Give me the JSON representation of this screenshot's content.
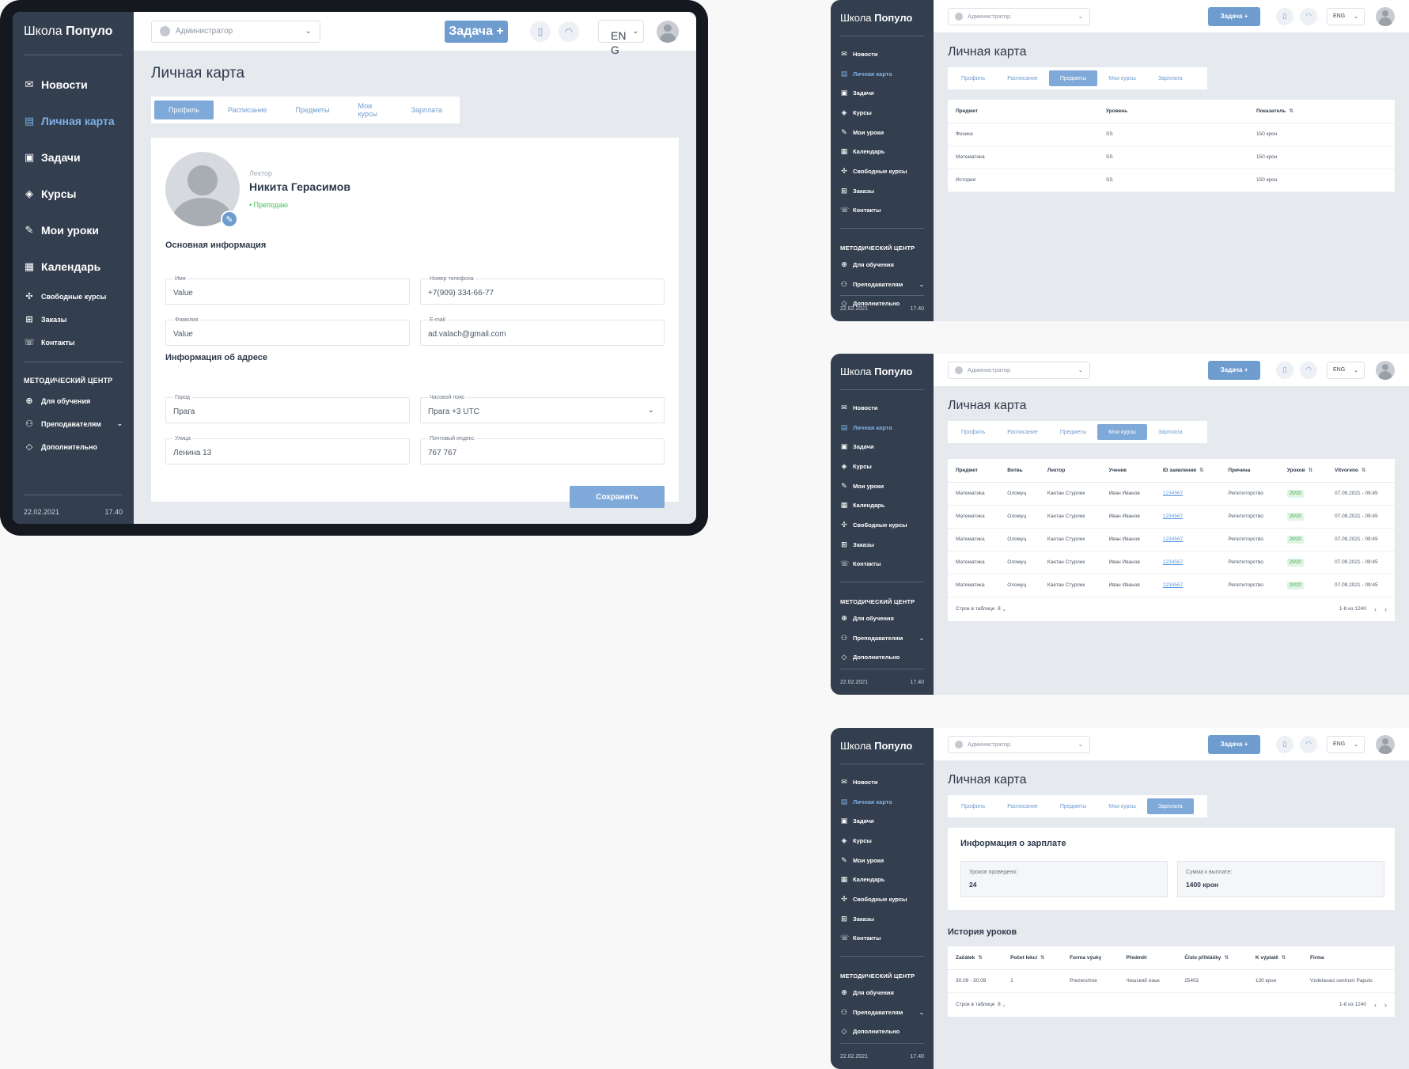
{
  "app": {
    "brand_light": "Школа",
    "brand_bold": "Популо"
  },
  "topbar": {
    "role": "Администратор",
    "task_button": "Задача +",
    "lang_large": "ENG",
    "lang_small": "ENG"
  },
  "sidebar_large": {
    "items": [
      {
        "label": "Новости",
        "icon": "mail-icon"
      },
      {
        "label": "Личная карта",
        "icon": "id-card-icon"
      },
      {
        "label": "Задачи",
        "icon": "inbox-icon"
      },
      {
        "label": "Курсы",
        "icon": "graduation-cap-icon"
      },
      {
        "label": "Мои уроки",
        "icon": "edit-icon"
      },
      {
        "label": "Календарь",
        "icon": "calendar-icon"
      }
    ],
    "small_items": [
      {
        "label": "Свободные курсы",
        "icon": "puzzle-icon"
      },
      {
        "label": "Заказы",
        "icon": "orders-icon"
      },
      {
        "label": "Контакты",
        "icon": "phone-icon"
      }
    ],
    "section": "МЕТОДИЧЕСКИЙ ЦЕНТР",
    "section_items": [
      {
        "label": "Для обучения",
        "icon": "add-folder-icon"
      },
      {
        "label": "Преподавателям",
        "icon": "users-icon"
      },
      {
        "label": "Дополнительно",
        "icon": "diamond-icon"
      }
    ],
    "date": "22.02.2021",
    "time": "17.40"
  },
  "sidebar_small": {
    "items": [
      "Новости",
      "Личная карта",
      "Задачи",
      "Курсы",
      "Мои уроки",
      "Календарь",
      "Свободные курсы",
      "Заказы",
      "Контакты"
    ],
    "section": "МЕТОДИЧЕСКИЙ ЦЕНТР",
    "section_items": [
      "Для обучения",
      "Преподавателям",
      "Дополнительно"
    ],
    "date": "22.02.2021",
    "time": "17.40"
  },
  "page_title": "Личная карта",
  "tabs": [
    "Профиль",
    "Расписание",
    "Предметы",
    "Мои курсы",
    "Зарплата"
  ],
  "profile": {
    "role": "Лектор",
    "name": "Никита Герасимов",
    "status": "• Преподаю",
    "basic_info_heading": "Основная информация",
    "address_heading": "Информация об адресе",
    "fields": {
      "first_name": {
        "label": "Имя",
        "value": "Value"
      },
      "phone": {
        "label": "Номер телефона",
        "value": "+7(909) 334-66-77"
      },
      "last_name": {
        "label": "Фамилия",
        "value": "Value"
      },
      "email": {
        "label": "E-mail",
        "value": "ad.valach@gmail.com"
      },
      "city": {
        "label": "Город",
        "value": "Прага"
      },
      "timezone": {
        "label": "Часовой пояс",
        "value": "Прага +3 UTC"
      },
      "street": {
        "label": "Улица",
        "value": "Ленина 13"
      },
      "zip": {
        "label": "Почтовый индекс",
        "value": "767 767"
      }
    },
    "save_button": "Сохранить"
  },
  "subjects": {
    "headers": [
      "Предмет",
      "Уровень",
      "Показатель"
    ],
    "rows": [
      [
        "Физика",
        "SS",
        "150 крон"
      ],
      [
        "Математика",
        "SS",
        "150 крон"
      ],
      [
        "История",
        "SS",
        "150 крон"
      ]
    ]
  },
  "courses": {
    "headers": [
      "Предмет",
      "Ветвь",
      "Лектор",
      "Ученик",
      "ID заявления",
      "Причина",
      "Уроков",
      "Vitvoreno"
    ],
    "rows": [
      [
        "Математика",
        "Оломуц",
        "Каетан Стурлик",
        "Иван Иванов",
        "1234567",
        "Репетиторство",
        "20/20",
        "07.09.2021 - 09:45"
      ],
      [
        "Математика",
        "Оломуц",
        "Каетан Стурлик",
        "Иван Иванов",
        "1234567",
        "Репетиторство",
        "20/20",
        "07.09.2021 - 09:45"
      ],
      [
        "Математика",
        "Оломуц",
        "Каетан Стурлик",
        "Иван Иванов",
        "1234567",
        "Репетиторство",
        "20/20",
        "07.09.2021 - 09:45"
      ],
      [
        "Математика",
        "Оломуц",
        "Каетан Стурлик",
        "Иван Иванов",
        "1234567",
        "Репетиторство",
        "20/20",
        "07.09.2021 - 09:45"
      ],
      [
        "Математика",
        "Оломуц",
        "Каетан Стурлик",
        "Иван Иванов",
        "1234567",
        "Репетиторство",
        "20/20",
        "07.09.2021 - 09:45"
      ]
    ],
    "rows_label": "Строк в таблице",
    "rows_value": "8",
    "range": "1-8 из 1240"
  },
  "salary": {
    "heading": "Информация о зарплате",
    "lessons_label": "Уроков проведено:",
    "lessons_value": "24",
    "sum_label": "Сумма к выплате:",
    "sum_value": "1400 крон",
    "history_heading": "История уроков",
    "headers": [
      "Začátek",
      "Počet lekcí",
      "Forma výuky",
      "Předmět",
      "Číslo přihlášky",
      "K výplatě",
      "Firma"
    ],
    "rows": [
      [
        "30.09 - 30.09",
        "1",
        "Prezenchne",
        "Чешский язык",
        "25402",
        "130 крон",
        "Vzdelavaci centrum Papulo"
      ]
    ],
    "rows_label": "Строк в таблице",
    "rows_value": "8",
    "range": "1-8 из 1240"
  },
  "colors": {
    "sidebar": "#333e4e",
    "accent": "#7fa9d8",
    "active_link": "#7fb0e6",
    "status_green": "#3ec157"
  }
}
